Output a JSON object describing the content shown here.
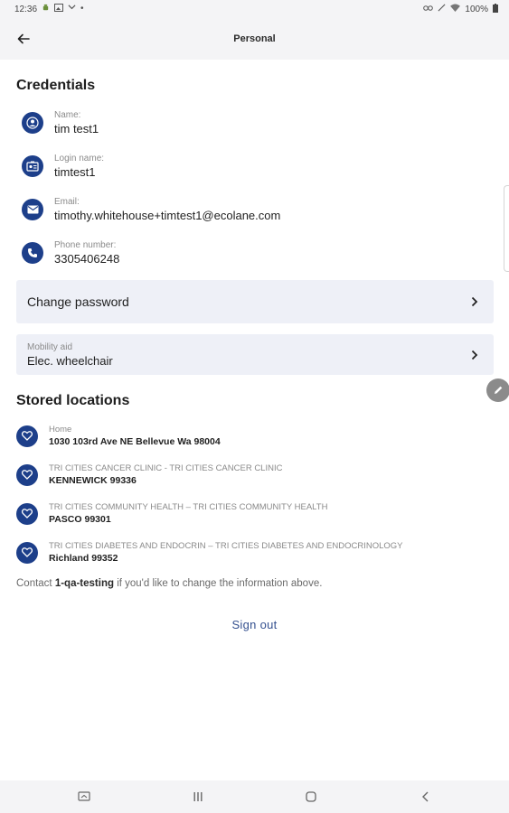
{
  "status_bar": {
    "time": "12:36",
    "battery": "100%"
  },
  "header": {
    "title": "Personal"
  },
  "credentials": {
    "heading": "Credentials",
    "items": [
      {
        "label": "Name:",
        "value": "tim test1",
        "icon": "person-icon"
      },
      {
        "label": "Login name:",
        "value": "timtest1",
        "icon": "id-card-icon"
      },
      {
        "label": "Email:",
        "value": "timothy.whitehouse+timtest1@ecolane.com",
        "icon": "mail-icon"
      },
      {
        "label": "Phone number:",
        "value": "3305406248",
        "icon": "phone-icon"
      }
    ]
  },
  "change_password": {
    "label": "Change password"
  },
  "mobility_aid": {
    "label": "Mobility aid",
    "value": "Elec. wheelchair"
  },
  "stored_locations": {
    "heading": "Stored locations",
    "items": [
      {
        "name": "Home",
        "address": "1030 103rd Ave NE Bellevue Wa 98004"
      },
      {
        "name": "TRI CITIES CANCER CLINIC - TRI CITIES CANCER CLINIC",
        "address": "KENNEWICK 99336"
      },
      {
        "name": "TRI CITIES COMMUNITY HEALTH – TRI CITIES COMMUNITY HEALTH",
        "address": "PASCO 99301"
      },
      {
        "name": "TRI CITIES DIABETES AND ENDOCRIN – TRI CITIES DIABETES AND ENDOCRINOLOGY",
        "address": "Richland 99352"
      }
    ]
  },
  "contact": {
    "prefix": "Contact ",
    "org": "1-qa-testing",
    "suffix": " if you'd like to change the information above."
  },
  "sign_out": {
    "label": "Sign out"
  },
  "colors": {
    "accent": "#1d3f8a",
    "card_bg": "#eef0f7",
    "link": "#34508f",
    "bar_bg": "#f4f4f6"
  }
}
